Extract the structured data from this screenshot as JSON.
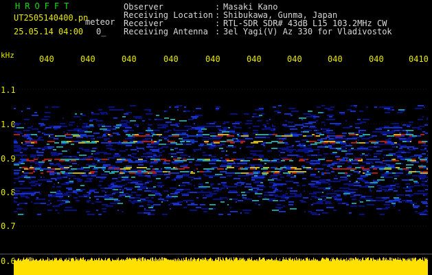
{
  "header": {
    "title": "HROFFT",
    "file_name": "UT2505140400.pn",
    "meteor_label": "meteor",
    "datetime": "25.05.14 04:00",
    "zero_label": "0_"
  },
  "metadata": [
    {
      "label": "Observer",
      "value": "Masaki Kano"
    },
    {
      "label": "Receiving Location",
      "value": "Shibukawa, Gunma, Japan"
    },
    {
      "label": "Receiver",
      "value": "RTL-SDR SDR# 43dB L15 103.2MHz CW"
    },
    {
      "label": "Receiving Antenna",
      "value": "3el Yagi(V) Az 330 for Vladivostok"
    }
  ],
  "axes": {
    "y_unit": "kHz",
    "y_ticks": [
      "1.1",
      "1.0",
      "0.9",
      "0.8",
      "0.7",
      "0.6"
    ],
    "x_ticks": [
      "040",
      "040",
      "040",
      "040",
      "040",
      "040",
      "040",
      "040",
      "040",
      "0410"
    ]
  },
  "colors": {
    "background": "#000000",
    "text_yellow": "#e8e800",
    "text_white": "#d8d8d8",
    "title_green": "#10e010",
    "signal_band": "#ffe000"
  }
}
